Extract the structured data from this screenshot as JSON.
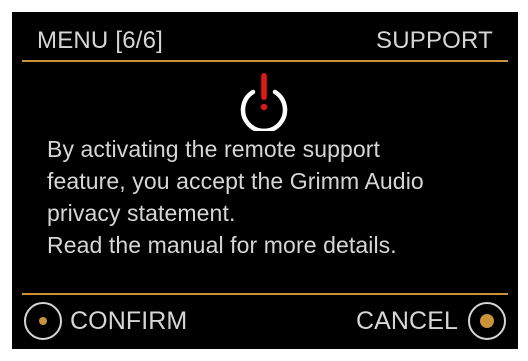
{
  "header": {
    "menu_label": "MENU [6/6]",
    "section_title": "SUPPORT"
  },
  "icons": {
    "warning": "power-warning-icon",
    "confirm_knob": "knob-press-icon",
    "cancel_knob": "knob-press-icon"
  },
  "message": {
    "lines": [
      "By activating the remote support",
      "feature, you accept the Grimm Audio",
      "privacy statement.",
      "Read the manual for more details."
    ]
  },
  "footer": {
    "confirm_label": "CONFIRM",
    "cancel_label": "CANCEL"
  },
  "colors": {
    "background": "#000000",
    "text": "#d6d6d6",
    "accent": "#c8933a",
    "warning": "#e01818",
    "icon": "#ffffff"
  }
}
